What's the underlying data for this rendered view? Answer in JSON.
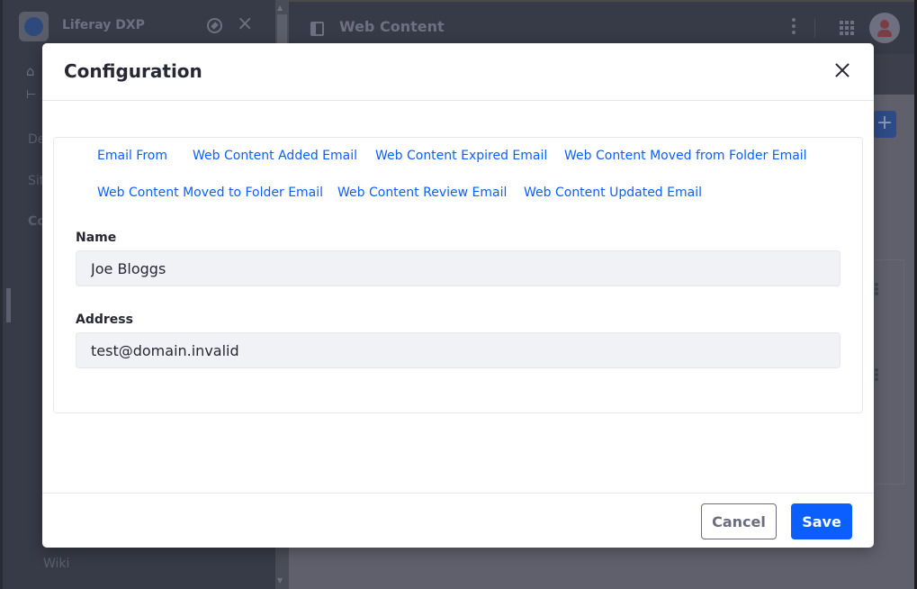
{
  "app": {
    "name": "Liferay DXP",
    "page_title": "Web Content",
    "sidebar_items": [
      "De",
      "Site",
      "Co"
    ],
    "sidebar_footer_item": "Wiki"
  },
  "modal": {
    "title": "Configuration",
    "tabs": [
      {
        "label": "Email From"
      },
      {
        "label": "Web Content Added Email"
      },
      {
        "label": "Web Content Expired Email"
      },
      {
        "label": "Web Content Moved from Folder Email"
      },
      {
        "label": "Web Content Moved to Folder Email"
      },
      {
        "label": "Web Content Review Email"
      },
      {
        "label": "Web Content Updated Email"
      }
    ],
    "fields": {
      "name": {
        "label": "Name",
        "value": "Joe Bloggs"
      },
      "address": {
        "label": "Address",
        "value": "test@domain.invalid"
      }
    },
    "footer": {
      "cancel_label": "Cancel",
      "save_label": "Save"
    }
  },
  "colors": {
    "primary": "#0b5fff",
    "text_dark": "#272833",
    "input_bg": "#f1f2f5"
  },
  "icons": {
    "add": "+",
    "close": "×"
  }
}
